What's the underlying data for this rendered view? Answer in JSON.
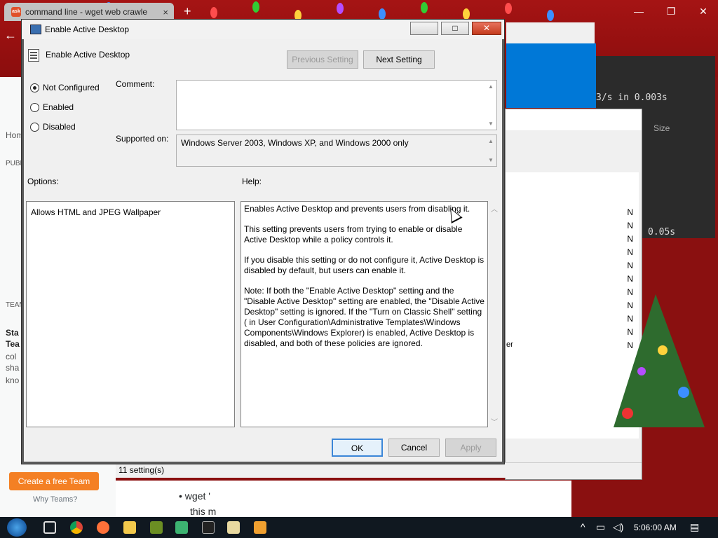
{
  "colors": {
    "desktop_red": "#a51414",
    "dialog_bg": "#f0f0f0",
    "close_red": "#c43b1d",
    "default_button_border": "#3b86d8",
    "taskbar": "#101820",
    "orange_button": "#f48024"
  },
  "browser": {
    "tab_title": "command line - wget web crawle",
    "tab_favicon": "ask",
    "new_tab_glyph": "+",
    "close_glyph": "×"
  },
  "background": {
    "left_nav": [
      "Hom",
      "PUBL",
      "TEAM",
      "Sta",
      "Tea",
      "col",
      "sha",
      "kno"
    ],
    "create_team": "Create a free Team",
    "why_teams": "Why Teams?",
    "bullet_text": "wget '",
    "bullet_text2": "this m",
    "terminal_lines": [
      "3/s    in 0.003s",
      "0.05s"
    ],
    "explorer_size_header": "Size",
    "explorer_rows": [
      "N",
      "N",
      "N",
      "N",
      "N",
      "N",
      "N",
      "N",
      "N",
      "N",
      "N"
    ],
    "explorer_row_suffix": "er",
    "status": "11 setting(s)"
  },
  "dialog": {
    "title": "Enable Active Desktop",
    "header_title": "Enable Active Desktop",
    "previous_setting": "Previous Setting",
    "next_setting": "Next Setting",
    "radios": [
      {
        "label": "Not Configured",
        "checked": true
      },
      {
        "label": "Enabled",
        "checked": false
      },
      {
        "label": "Disabled",
        "checked": false
      }
    ],
    "comment_label": "Comment:",
    "comment_value": "",
    "supported_label": "Supported on:",
    "supported_value": "Windows Server 2003, Windows XP, and Windows 2000 only",
    "options_label": "Options:",
    "help_label": "Help:",
    "options_text": "Allows HTML and JPEG Wallpaper",
    "help_paragraphs": [
      "Enables Active Desktop and prevents users from disabling it.",
      "This setting prevents users from trying to enable or disable Active Desktop while a policy controls it.",
      "If you disable this setting or do not configure it, Active Desktop is disabled by default, but users can enable it.",
      "Note: If both the \"Enable Active Desktop\" setting and the \"Disable Active Desktop\" setting are enabled, the \"Disable Active Desktop\" setting is ignored.  If the \"Turn on Classic Shell\" setting ( in User Configuration\\Administrative Templates\\Windows Components\\Windows Explorer) is enabled, Active Desktop is disabled, and both of these policies are ignored."
    ],
    "ok": "OK",
    "cancel": "Cancel",
    "apply": "Apply",
    "minimize_glyph": "",
    "maximize_glyph": "□",
    "close_glyph": "✕"
  },
  "taskbar": {
    "time": "5:06:00 AM",
    "tray_icons": [
      "chevron-up-icon",
      "network-icon",
      "volume-icon",
      "notification-icon"
    ]
  }
}
